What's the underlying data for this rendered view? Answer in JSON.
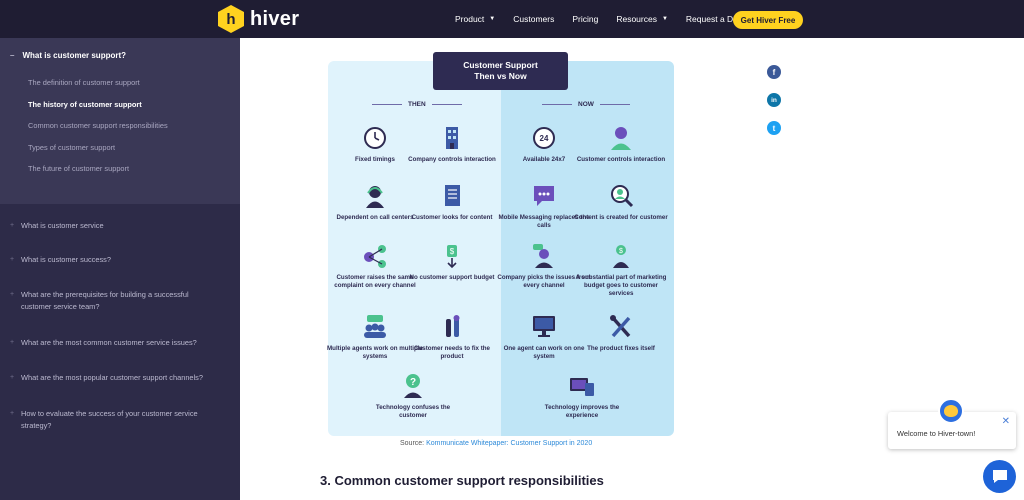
{
  "nav": {
    "brand": "hiver",
    "items": [
      {
        "label": "Product",
        "has_dropdown": true
      },
      {
        "label": "Customers",
        "has_dropdown": false
      },
      {
        "label": "Pricing",
        "has_dropdown": false
      },
      {
        "label": "Resources",
        "has_dropdown": true
      },
      {
        "label": "Request a Demo",
        "has_dropdown": false
      }
    ],
    "cta": "Get Hiver Free",
    "colors": {
      "bg": "#1f1d33",
      "accent": "#ffd21f"
    }
  },
  "sidebar": {
    "active_section": "What is customer support?",
    "subitems": [
      "The definition of customer support",
      "The history of customer support",
      "Common customer support responsibilities",
      "Types of customer support",
      "The future of customer support"
    ],
    "current_subitem_index": 1,
    "sections": [
      "What is customer service",
      "What is customer success?",
      "What are the prerequisites for building a successful customer service team?",
      "What are the most common customer service issues?",
      "What are the most popular customer support channels?",
      "How to evaluate the success of your customer service strategy?"
    ]
  },
  "infographic": {
    "title_line1": "Customer Support",
    "title_line2": "Then vs Now",
    "then_label": "THEN",
    "now_label": "NOW",
    "then_items": [
      {
        "label": "Fixed timings",
        "icon": "clock-icon"
      },
      {
        "label": "Company controls interaction",
        "icon": "building-icon"
      },
      {
        "label": "Dependent on call centers",
        "icon": "headset-agent-icon"
      },
      {
        "label": "Customer looks for content",
        "icon": "document-icon"
      },
      {
        "label": "Customer raises the same complaint on every channel",
        "icon": "share-network-icon"
      },
      {
        "label": "No customer support budget",
        "icon": "money-icon"
      },
      {
        "label": "Multiple agents work on multiple systems",
        "icon": "team-chat-icon"
      },
      {
        "label": "Customer needs to fix the product",
        "icon": "tools-icon"
      },
      {
        "label": "Technology confuses the customer",
        "icon": "confused-user-icon"
      }
    ],
    "now_items": [
      {
        "label": "Available 24x7",
        "icon": "24-7-icon"
      },
      {
        "label": "Customer controls interaction",
        "icon": "user-icon"
      },
      {
        "label": "Mobile Messaging replaces the calls",
        "icon": "chat-bubble-icon"
      },
      {
        "label": "Content is created for customer",
        "icon": "magnifier-user-icon"
      },
      {
        "label": "Company picks the issues from every channel",
        "icon": "agent-icon"
      },
      {
        "label": "A substantial part of marketing budget goes to customer services",
        "icon": "investment-icon"
      },
      {
        "label": "One agent can work on one system",
        "icon": "monitor-icon"
      },
      {
        "label": "The product fixes itself",
        "icon": "wrench-icon"
      },
      {
        "label": "Technology improves the experience",
        "icon": "devices-icon"
      }
    ]
  },
  "source": {
    "prefix": "Source: ",
    "link_text": "Kommunicate Whitepaper: Customer Support in 2020"
  },
  "section_title": "3. Common customer support responsibilities",
  "share": {
    "facebook": "f",
    "linkedin": "in",
    "twitter": "t"
  },
  "chat": {
    "greeting": "Welcome to Hiver-town!",
    "close": "✕"
  }
}
